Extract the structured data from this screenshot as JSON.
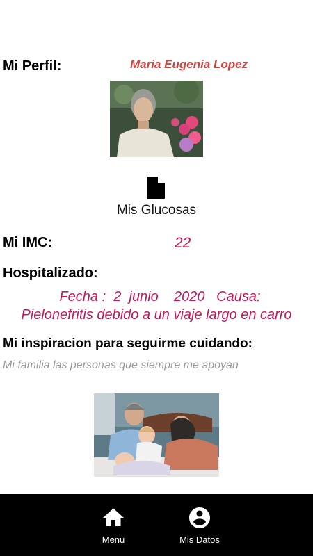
{
  "profile": {
    "label": "Mi Perfil:",
    "name": "Maria Eugenia Lopez"
  },
  "glucosas": {
    "icon": "document-icon",
    "label": "Mis Glucosas"
  },
  "imc": {
    "label": "Mi IMC:",
    "value": "22"
  },
  "hospitalizado": {
    "label": "Hospitalizado:",
    "line1": "Fecha :  2  junio    2020   Causa:",
    "line2": "Pielonefritis debido a un viaje largo en carro"
  },
  "inspiracion": {
    "label": "Mi inspiracion para seguirme cuidando:",
    "text": "Mi familia las personas que siempre me apoyan"
  },
  "bottom_nav": {
    "items": [
      {
        "label": "Menu",
        "icon": "home-icon"
      },
      {
        "label": "Mis Datos",
        "icon": "account-circle-icon"
      }
    ]
  },
  "colors": {
    "name_color": "#d0443f",
    "accent": "#c2185b",
    "muted": "#9a9a9a",
    "nav_bg": "#000000"
  }
}
